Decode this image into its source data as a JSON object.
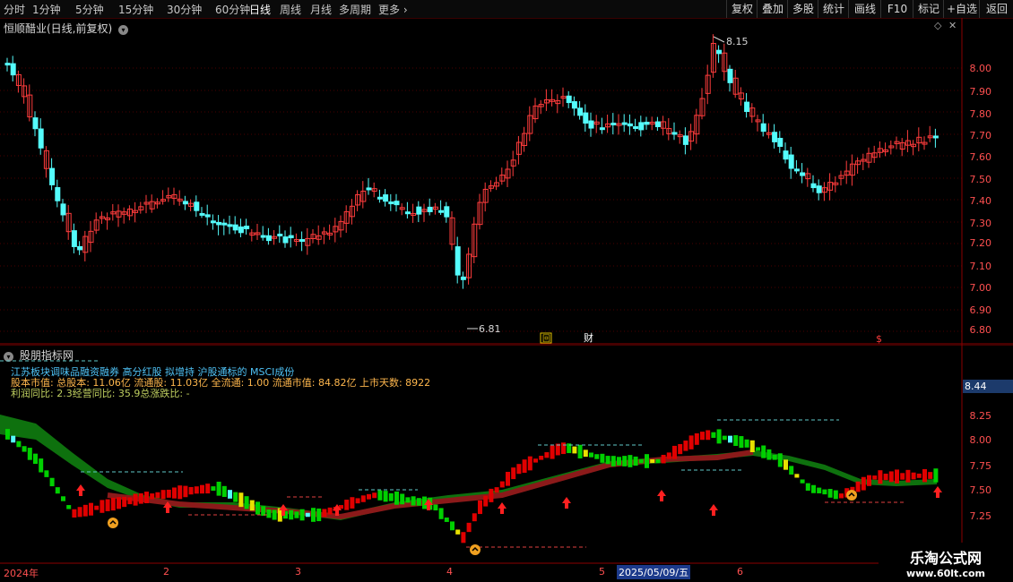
{
  "toolbar": {
    "timeframes": [
      "分时",
      "1分钟",
      "5分钟",
      "15分钟",
      "30分钟",
      "60分钟",
      "日线",
      "周线",
      "月线",
      "多周期",
      "更多"
    ],
    "buttons": [
      "复权",
      "叠加",
      "多股",
      "统计",
      "画线",
      "F10",
      "标记",
      "+自选",
      "返回"
    ]
  },
  "main_chart": {
    "title": "恒顺醋业(日线,前复权)",
    "price_axis": [
      "8.00",
      "7.90",
      "7.80",
      "7.70",
      "7.60",
      "7.50",
      "7.40",
      "7.30",
      "7.20",
      "7.10",
      "7.00",
      "6.90",
      "6.80"
    ],
    "high_label": "8.15",
    "low_label": "6.81",
    "markers": [
      "回",
      "财",
      "$"
    ]
  },
  "indicator": {
    "title": "股朋指标网",
    "line1": "江苏板块调味品融资融券 高分红股 拟增持 沪股通标的 MSCI成份",
    "line2": "股本市值: 总股本: 11.06亿 流通股: 11.03亿 全流通: 1.00 流通市值: 84.82亿 上市天数: 8922",
    "line3": "利润同比: 2.3经营同比: 35.9总涨跌比: -",
    "value_badge": "8.44",
    "price_axis": [
      "8.25",
      "8.00",
      "7.75",
      "7.50",
      "7.25"
    ]
  },
  "time_axis": {
    "labels": [
      "2024年",
      "2",
      "3",
      "4",
      "5",
      "6"
    ],
    "highlight": "2025/05/09/五"
  },
  "watermark": {
    "line1": "乐淘公式网",
    "line2": "www.60lt.com"
  },
  "colors": {
    "up": "#ff3c3c",
    "down": "#54fcfc",
    "accent": "#ff0000"
  }
}
